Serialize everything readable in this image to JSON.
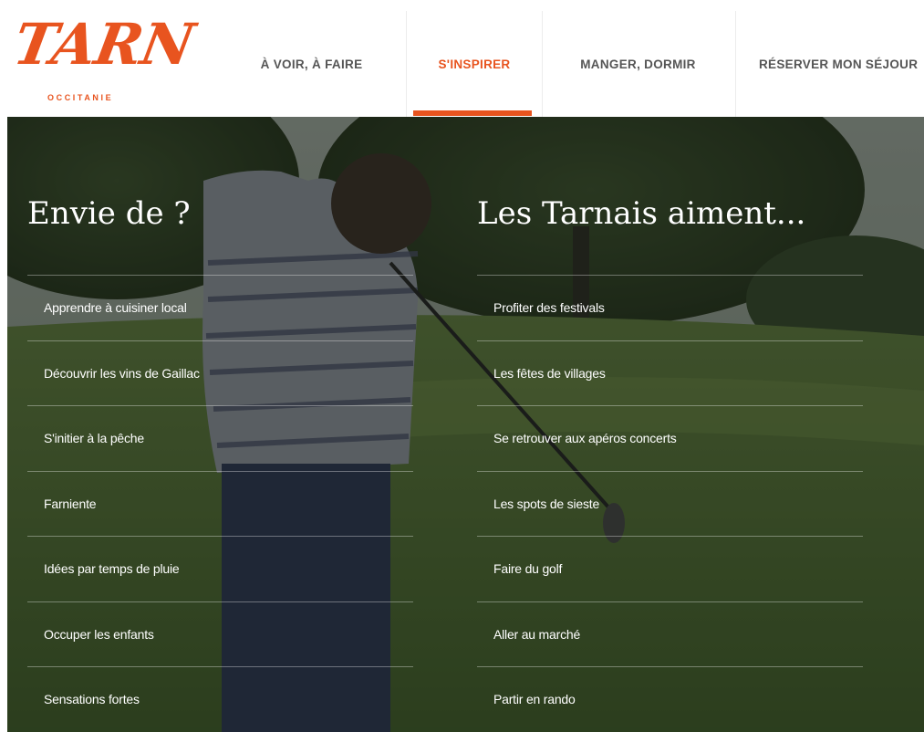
{
  "brand": {
    "logo_text": "TARN",
    "logo_subtitle": "OCCITANIE",
    "accent_color": "#e8541f"
  },
  "nav": {
    "items": [
      {
        "label": "À VOIR, À FAIRE",
        "active": false
      },
      {
        "label": "S'INSPIRER",
        "active": true
      },
      {
        "label": "MANGER, DORMIR",
        "active": false
      },
      {
        "label": "RÉSERVER MON SÉJOUR",
        "active": false
      }
    ]
  },
  "menu": {
    "left": {
      "title": "Envie de ?",
      "items": [
        "Apprendre à cuisiner local",
        "Découvrir les vins de Gaillac",
        "S'initier à la pêche",
        "Farniente",
        "Idées par temps de pluie",
        "Occuper les enfants",
        "Sensations fortes"
      ]
    },
    "right": {
      "title": "Les Tarnais aiment...",
      "items": [
        "Profiter des festivals",
        "Les fêtes de villages",
        "Se retrouver aux apéros concerts",
        "Les spots de sieste",
        "Faire du golf",
        "Aller au marché",
        "Partir en rando"
      ]
    }
  }
}
